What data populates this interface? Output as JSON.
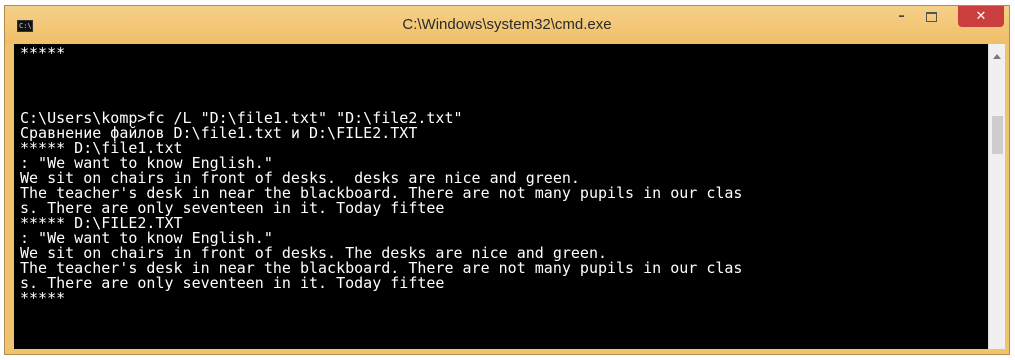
{
  "window": {
    "title": "C:\\Windows\\system32\\cmd.exe",
    "icon_text": "C:\\"
  },
  "controls": {
    "minimize": "–",
    "maximize": "□",
    "close": "✕"
  },
  "console": {
    "lines": [
      "*****",
      "",
      "",
      "C:\\Users\\komp>fc /L \"D:\\file1.txt\" \"D:\\file2.txt\"",
      "Сравнение файлов D:\\file1.txt и D:\\FILE2.TXT",
      "***** D:\\file1.txt",
      ": \"We want to know English.\"",
      "We sit on chairs in front of desks.  desks are nice and green.",
      "The teacher's desk in near the blackboard. There are not many pupils in our clas",
      "s. There are only seventeen in it. Today fiftee",
      "***** D:\\FILE2.TXT",
      ": \"We want to know English.\"",
      "We sit on chairs in front of desks. The desks are nice and green.",
      "The teacher's desk in near the blackboard. There are not many pupils in our clas",
      "s. There are only seventeen in it. Today fiftee",
      "*****"
    ]
  },
  "colors": {
    "titlebar": "#f2c36f",
    "console_bg": "#000000",
    "console_text": "#ffffff",
    "close_button": "#cb3e3e"
  }
}
